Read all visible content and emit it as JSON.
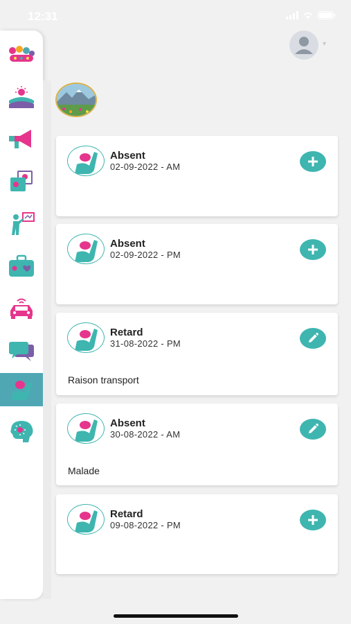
{
  "status_bar": {
    "time": "12:31"
  },
  "sidebar": {
    "items": [
      {
        "name": "kool-kids-logo-icon",
        "active": false
      },
      {
        "name": "landscape-sun-icon",
        "active": false
      },
      {
        "name": "megaphone-icon",
        "active": false
      },
      {
        "name": "photo-gallery-icon",
        "active": false
      },
      {
        "name": "teacher-board-icon",
        "active": false
      },
      {
        "name": "medical-bag-icon",
        "active": false
      },
      {
        "name": "car-icon",
        "active": false
      },
      {
        "name": "chat-bubbles-icon",
        "active": false
      },
      {
        "name": "raised-hand-icon",
        "active": true
      },
      {
        "name": "brain-icon",
        "active": false
      }
    ]
  },
  "records": [
    {
      "type": "Absent",
      "date": "02-09-2022 - AM",
      "reason": "",
      "action": "add"
    },
    {
      "type": "Absent",
      "date": "02-09-2022 - PM",
      "reason": "",
      "action": "add"
    },
    {
      "type": "Retard",
      "date": "31-08-2022 - PM",
      "reason": "Raison  transport",
      "action": "edit"
    },
    {
      "type": "Absent",
      "date": "30-08-2022 - AM",
      "reason": "Malade",
      "action": "edit"
    },
    {
      "type": "Retard",
      "date": "09-08-2022 - PM",
      "reason": "",
      "action": "add"
    }
  ],
  "colors": {
    "accent": "#3fb5b0",
    "active_sidebar": "#4fa7b4",
    "magenta": "#e6358c"
  }
}
